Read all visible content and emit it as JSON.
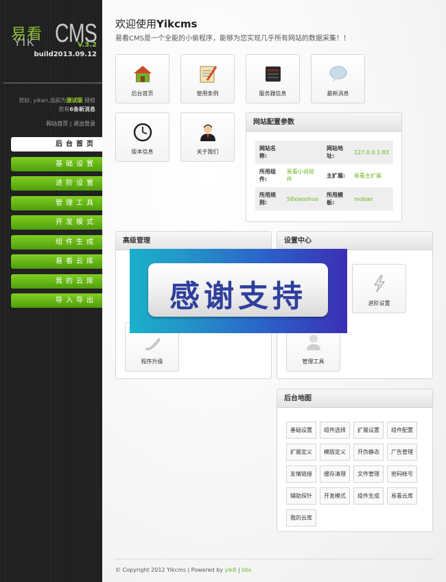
{
  "logo": {
    "cn": "易看",
    "yik": "YIK",
    "cms": "CMS",
    "version": "V.3.2",
    "build": "build2013.09.12"
  },
  "user": {
    "line1_pre": "您好, yikan,当前为",
    "edition": "测试版",
    "line1_post": "授权",
    "line2_pre": "您有",
    "count": "6",
    "line2_post": "条新消息"
  },
  "quick_links": {
    "home": "网站首页",
    "sep": " | ",
    "logout": "退出登录"
  },
  "nav": [
    {
      "label": "后台首页",
      "active": true
    },
    {
      "label": "基础设置"
    },
    {
      "label": "进阶设置"
    },
    {
      "label": "管理工具"
    },
    {
      "label": "开发模式"
    },
    {
      "label": "组件生成"
    },
    {
      "label": "易看云库"
    },
    {
      "label": "我的云库"
    },
    {
      "label": "导入导出"
    }
  ],
  "welcome": {
    "pre": "欢迎使用",
    "brand": "Yikcms",
    "subtitle": "易看CMS是一个全能的小偷程序，能够为您实现几乎所有网站的数据采集！！"
  },
  "tiles": [
    {
      "label": "后台首页",
      "icon": "house-icon"
    },
    {
      "label": "使用条例",
      "icon": "notepad-icon"
    },
    {
      "label": "服务器信息",
      "icon": "server-icon"
    },
    {
      "label": "最新消息",
      "icon": "speech-bubble-icon"
    },
    {
      "label": "版本信息",
      "icon": "clock-icon"
    },
    {
      "label": "关于我们",
      "icon": "person-icon"
    }
  ],
  "config": {
    "title": "网站配置参数",
    "rows": [
      [
        {
          "k": "网站名称:",
          "v": ""
        },
        {
          "k": "网站地址:",
          "v": "127.0.0.1:83"
        }
      ],
      [
        {
          "k": "所用组件:",
          "v": "易看小说组件"
        },
        {
          "k": "主扩展:",
          "v": "易看主扩展"
        }
      ],
      [
        {
          "k": "所用规则:",
          "v": "58xiaoshuo"
        },
        {
          "k": "所用模板:",
          "v": "moban"
        }
      ]
    ]
  },
  "advanced": {
    "title": "高级管理",
    "tile_label": "程序升级"
  },
  "settings": {
    "title": "设置中心",
    "tile1_label": "进阶设置",
    "tile2_label": "管理工具"
  },
  "banner": {
    "text": "感谢支持"
  },
  "sitemap": {
    "title": "后台地图",
    "items": [
      "基础设置",
      "组件选择",
      "扩展设置",
      "组件配置",
      "扩展定义",
      "模版定义",
      "开伪静态",
      "广告管理",
      "友情链接",
      "缓存清理",
      "文件管理",
      "密码帐号",
      "辅助探针",
      "开发模式",
      "组件生成",
      "易看云库",
      "我的云库"
    ]
  },
  "footer": {
    "copyright": "© Copyright 2012 Yikcms | Powered by ",
    "yik8": "yik8",
    "sep": " | ",
    "bbs": "bbs"
  }
}
